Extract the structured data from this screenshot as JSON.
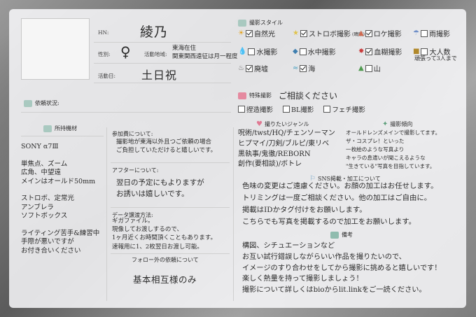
{
  "profile": {
    "hn_label": "HN:",
    "hn_value": "綾乃",
    "gender_label": "性別:",
    "gender_value": "♀",
    "area_label": "活動地域:",
    "area_value": "東海在住\n関東関西遠征は月一程度",
    "days_label": "活動日:",
    "days_value": "土日祝"
  },
  "request_status_label": "依頼状況:",
  "style": {
    "title": "撮影スタイル",
    "items": [
      {
        "icon": "☀",
        "label": "自然光",
        "checked": true,
        "color": "#e3a21a"
      },
      {
        "icon": "★",
        "label": "ストロボ撮影",
        "note": "(晴所)",
        "checked": true,
        "color": "#e0c34a"
      },
      {
        "icon": "▲",
        "label": "ロケ撮影",
        "checked": true,
        "color": "#d06a50"
      },
      {
        "icon": "☂",
        "label": "雨撮影",
        "checked": false,
        "color": "#6f8fc8"
      },
      {
        "icon": "💧",
        "label": "水撮影",
        "checked": false,
        "color": "#5a9bd0"
      },
      {
        "icon": "◆",
        "label": "水中撮影",
        "checked": false,
        "color": "#3f7fb0"
      },
      {
        "icon": "✸",
        "label": "血糊撮影",
        "checked": true,
        "color": "#c83a3a"
      },
      {
        "icon": "■",
        "label": "大人数",
        "note": "頑張って3人まで",
        "checked": false,
        "color": "#b0882a"
      },
      {
        "icon": "♨",
        "label": "廃墟",
        "checked": true,
        "color": "#666666"
      },
      {
        "icon": "≈",
        "label": "海",
        "checked": true,
        "color": "#4aa0c0"
      },
      {
        "icon": "▲",
        "label": "山",
        "checked": false,
        "color": "#4f9a4f"
      }
    ]
  },
  "special": {
    "title": "特殊撮影",
    "consult": "ご相談ください",
    "items": [
      {
        "label": "捏造撮影",
        "checked": false
      },
      {
        "label": "BL撮影",
        "checked": false
      },
      {
        "label": "フェチ撮影",
        "checked": false
      }
    ]
  },
  "equipment": {
    "title": "所持機材",
    "text": "SONY α7Ⅲ\n\n単焦点、ズーム\n広角、中望遠\nメインはオールド50mm\n\nストロボ、定常光\nアンブレラ\nソフトボックス\n\nライティング苦手&練習中\n手際が悪いですが\nお付き合いください"
  },
  "fee": {
    "title": "参加費について:",
    "text": "撮影地が東海以外且つご依頼の場合\nご負担していただけると嬉しいです。"
  },
  "after": {
    "title": "アフターについて:",
    "text": "翌日の予定にもよりますが\nお誘いは嬉しいです。"
  },
  "data_delivery": {
    "title": "データ譲渡方法:",
    "text": "ギガファイル。\n現像してお渡しするので、\n1ヶ月近くお時間頂くこともあります。\n速報用に1、2枚翌日お渡し可能。"
  },
  "follower": {
    "title": "フォロー外の依頼について",
    "text": "基本相互様のみ"
  },
  "genre": {
    "title": "撮りたいジャンル",
    "text": "呪術/twst/HQ/チェンソーマン\nヒプマイ/刀剣/ブルピ/東リベ\n黒執事/鬼徹/REBORN\n創作(要相談)/ボトレ"
  },
  "tendency": {
    "title": "撮影傾向",
    "text": "オールドレンズメインで撮影してます。\nザ・コスプレ！といった\n一枚絵のような写真より\nキャラの息遣いが聞こえるような\n\"生きている\"写真を目指しています。"
  },
  "sns": {
    "title": "SNS掲載・加工について",
    "text": "色味の変更はご遠慮ください。お顔の加工はお任せします。\nトリミングは一度ご相談ください。他の加工はご自由に。\n掲載はIDかタグ付けをお願いします。\nこちらでも写真を掲載するので加工をお願いします。"
  },
  "notes": {
    "title": "備考",
    "text": "構図、シチュエーションなど\nお互い試行錯誤しながらいい作品を撮りたいので、\nイメージのすり合わせをしてから撮影に挑めると嬉しいです！\n楽しく熱量を持って撮影しましょう！\n撮影について詳しくはbioからlit.linkをご一読ください。"
  }
}
